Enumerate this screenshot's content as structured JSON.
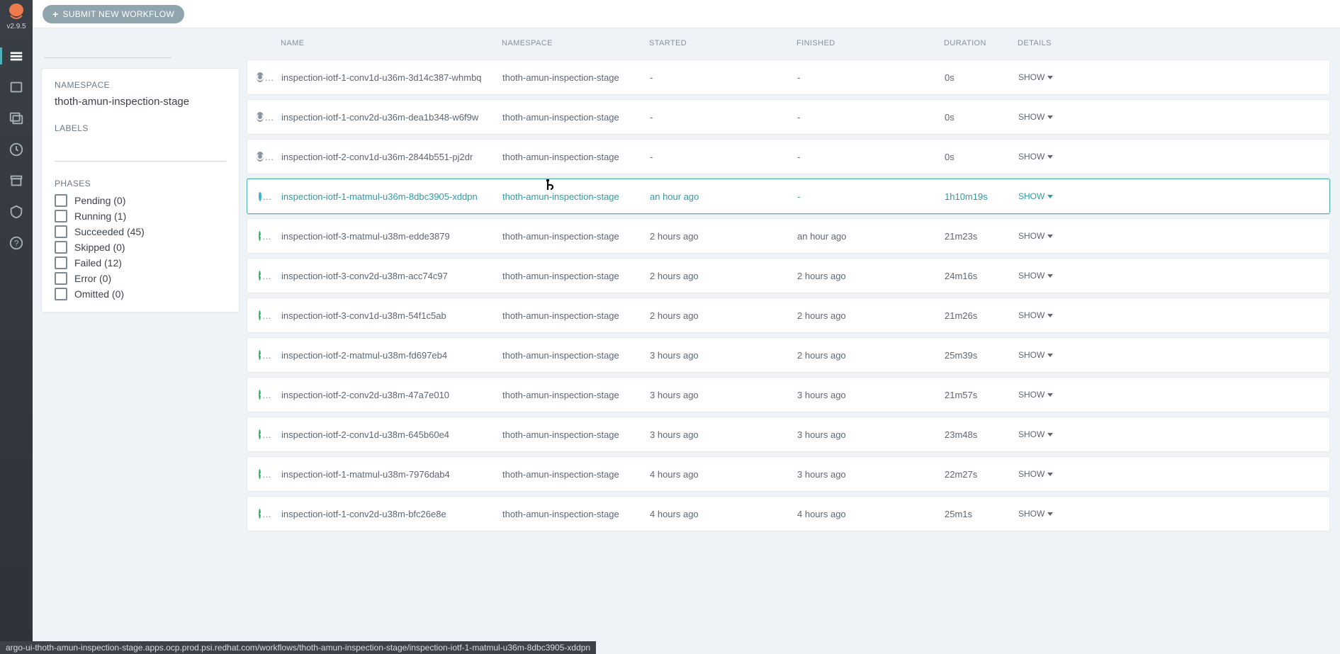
{
  "version": "v2.9.5",
  "topbar": {
    "submit_label": "SUBMIT NEW WORKFLOW"
  },
  "filters": {
    "namespace_label": "NAMESPACE",
    "namespace_value": "thoth-amun-inspection-stage",
    "labels_label": "LABELS",
    "phases_label": "PHASES",
    "phases": [
      {
        "label": "Pending (0)"
      },
      {
        "label": "Running (1)"
      },
      {
        "label": "Succeeded (45)"
      },
      {
        "label": "Skipped (0)"
      },
      {
        "label": "Failed (12)"
      },
      {
        "label": "Error (0)"
      },
      {
        "label": "Omitted (0)"
      }
    ]
  },
  "columns": {
    "name": "NAME",
    "namespace": "NAMESPACE",
    "started": "STARTED",
    "finished": "FINISHED",
    "duration": "DURATION",
    "details": "DETAILS"
  },
  "show_label": "SHOW",
  "workflows": [
    {
      "status": "pending",
      "name": "inspection-iotf-1-conv1d-u36m-3d14c387-whmbq",
      "namespace": "thoth-amun-inspection-stage",
      "started": "-",
      "finished": "-",
      "duration": "0s"
    },
    {
      "status": "pending",
      "name": "inspection-iotf-1-conv2d-u36m-dea1b348-w6f9w",
      "namespace": "thoth-amun-inspection-stage",
      "started": "-",
      "finished": "-",
      "duration": "0s"
    },
    {
      "status": "pending",
      "name": "inspection-iotf-2-conv1d-u36m-2844b551-pj2dr",
      "namespace": "thoth-amun-inspection-stage",
      "started": "-",
      "finished": "-",
      "duration": "0s"
    },
    {
      "status": "running",
      "name": "inspection-iotf-1-matmul-u36m-8dbc3905-xddpn",
      "namespace": "thoth-amun-inspection-stage",
      "started": "an hour ago",
      "finished": "-",
      "duration": "1h10m19s",
      "highlight": true
    },
    {
      "status": "success",
      "name": "inspection-iotf-3-matmul-u38m-edde3879",
      "namespace": "thoth-amun-inspection-stage",
      "started": "2 hours ago",
      "finished": "an hour ago",
      "duration": "21m23s"
    },
    {
      "status": "success",
      "name": "inspection-iotf-3-conv2d-u38m-acc74c97",
      "namespace": "thoth-amun-inspection-stage",
      "started": "2 hours ago",
      "finished": "2 hours ago",
      "duration": "24m16s"
    },
    {
      "status": "success",
      "name": "inspection-iotf-3-conv1d-u38m-54f1c5ab",
      "namespace": "thoth-amun-inspection-stage",
      "started": "2 hours ago",
      "finished": "2 hours ago",
      "duration": "21m26s"
    },
    {
      "status": "success",
      "name": "inspection-iotf-2-matmul-u38m-fd697eb4",
      "namespace": "thoth-amun-inspection-stage",
      "started": "3 hours ago",
      "finished": "2 hours ago",
      "duration": "25m39s"
    },
    {
      "status": "success",
      "name": "inspection-iotf-2-conv2d-u38m-47a7e010",
      "namespace": "thoth-amun-inspection-stage",
      "started": "3 hours ago",
      "finished": "3 hours ago",
      "duration": "21m57s"
    },
    {
      "status": "success",
      "name": "inspection-iotf-2-conv1d-u38m-645b60e4",
      "namespace": "thoth-amun-inspection-stage",
      "started": "3 hours ago",
      "finished": "3 hours ago",
      "duration": "23m48s"
    },
    {
      "status": "success",
      "name": "inspection-iotf-1-matmul-u38m-7976dab4",
      "namespace": "thoth-amun-inspection-stage",
      "started": "4 hours ago",
      "finished": "3 hours ago",
      "duration": "22m27s"
    },
    {
      "status": "success",
      "name": "inspection-iotf-1-conv2d-u38m-bfc26e8e",
      "namespace": "thoth-amun-inspection-stage",
      "started": "4 hours ago",
      "finished": "4 hours ago",
      "duration": "25m1s"
    }
  ],
  "statusbar": "argo-ui-thoth-amun-inspection-stage.apps.ocp.prod.psi.redhat.com/workflows/thoth-amun-inspection-stage/inspection-iotf-1-matmul-u36m-8dbc3905-xddpn"
}
